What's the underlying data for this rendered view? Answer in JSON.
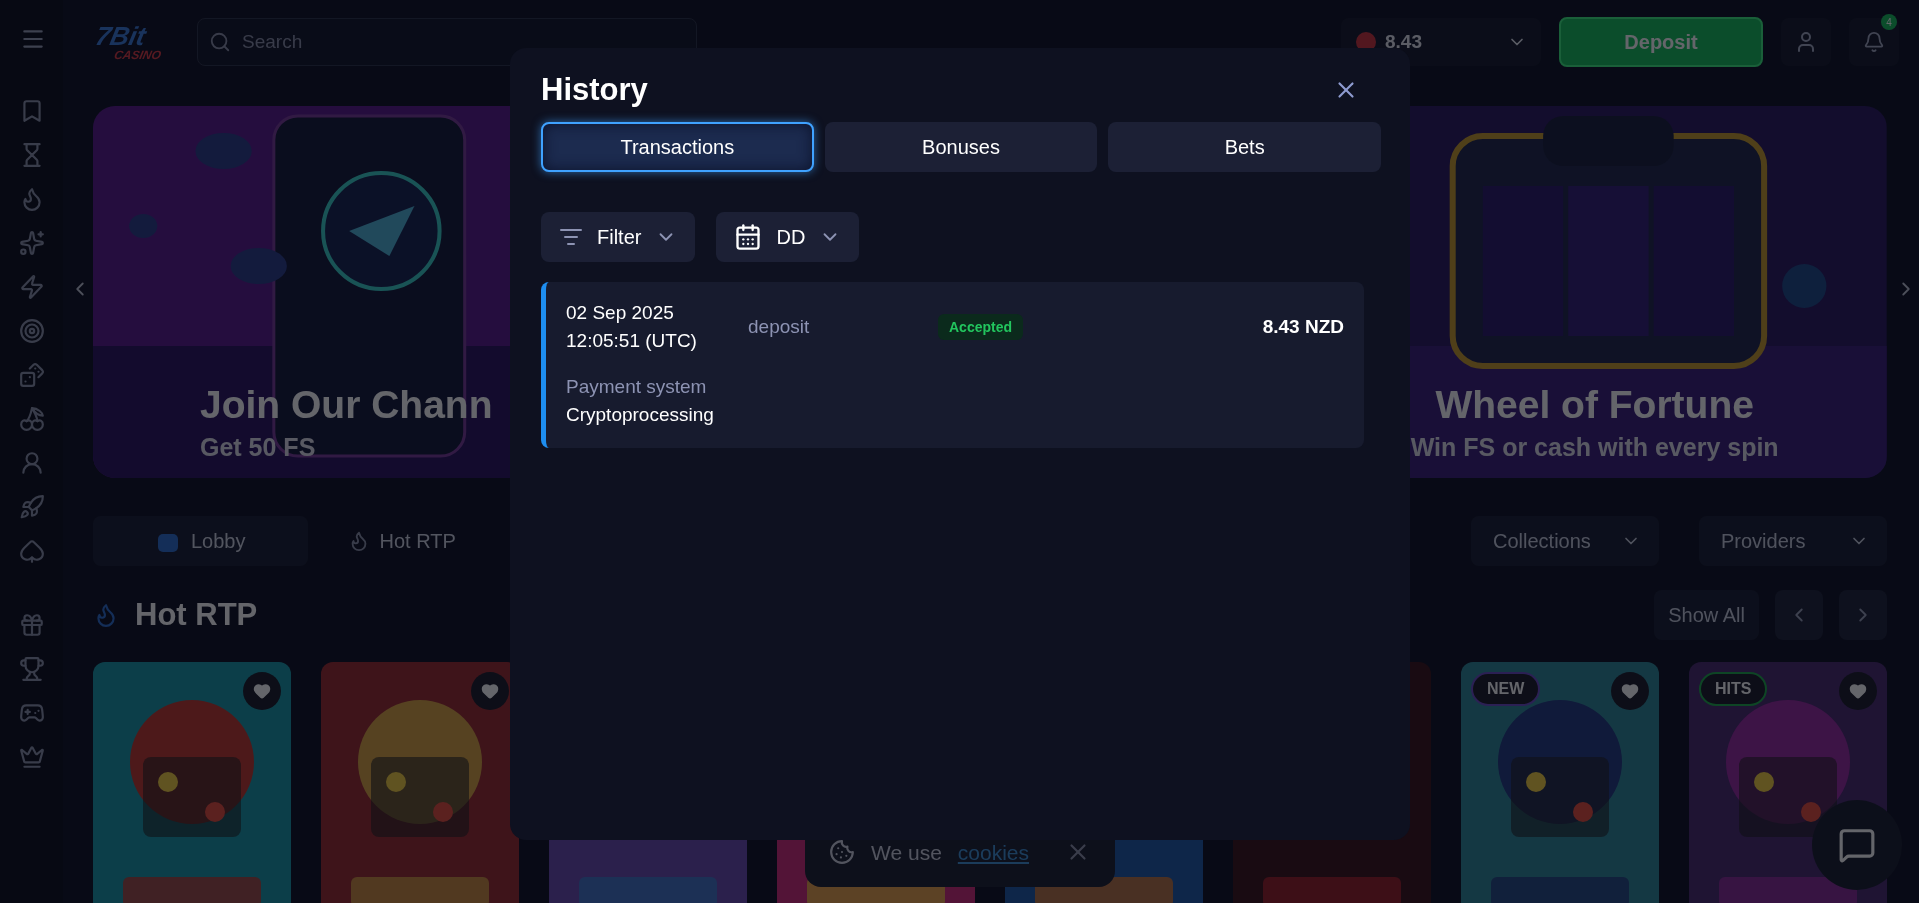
{
  "header": {
    "logo": {
      "name": "7Bit",
      "sub": "CASINO"
    },
    "search_placeholder": "Search",
    "balance": "8.43",
    "deposit": "Deposit",
    "notification_count": "4"
  },
  "banners": [
    {
      "title": "Join Our Chann",
      "subtitle": "Get 50 FS"
    },
    {
      "title": "Wheel of Fortune",
      "subtitle": "Win FS or cash with every spin"
    }
  ],
  "category_tabs": [
    {
      "label": "Lobby",
      "selected": true
    },
    {
      "label": "Hot RTP",
      "selected": false
    }
  ],
  "dropdowns": [
    "Collections",
    "Providers"
  ],
  "section": {
    "title": "Hot RTP",
    "show_all": "Show All"
  },
  "games": [
    {
      "heart_button": true
    },
    {
      "heart_button": true
    },
    {
      "heart_button": false
    },
    {
      "heart_button": false
    },
    {
      "heart_button": false
    },
    {
      "heart_button": false
    },
    {
      "heart_button": true,
      "badge": "NEW",
      "kind": "new"
    },
    {
      "heart_button": true,
      "badge": "HITS",
      "kind": "hits"
    }
  ],
  "cookie_notice": {
    "text": "We use",
    "link": "cookies"
  },
  "modal": {
    "title": "History",
    "tabs": [
      {
        "label": "Transactions",
        "selected": true
      },
      {
        "label": "Bonuses",
        "selected": false
      },
      {
        "label": "Bets",
        "selected": false
      }
    ],
    "filter": "Filter",
    "date_filter": "DD",
    "transactions": [
      {
        "date": "02 Sep 2025",
        "time": "12:05:51 (UTC)",
        "type": "deposit",
        "status": "Accepted",
        "amount": "8.43 NZD",
        "detail_label": "Payment system",
        "detail_value": "Cryptoprocessing"
      }
    ]
  }
}
